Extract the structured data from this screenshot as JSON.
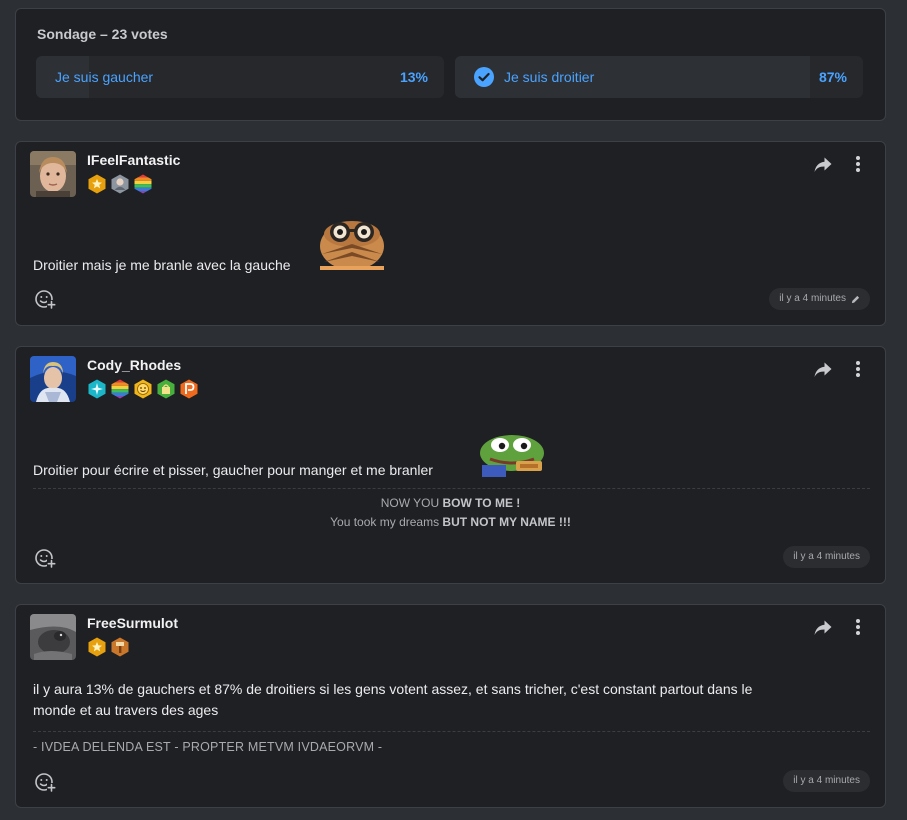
{
  "poll": {
    "title": "Sondage – 23 votes",
    "options": [
      {
        "label": "Je suis gaucher",
        "percent_label": "13%",
        "percent": 13,
        "selected": false
      },
      {
        "label": "Je suis droitier",
        "percent_label": "87%",
        "percent": 87,
        "selected": true
      }
    ]
  },
  "posts": [
    {
      "username": "IFeelFantastic",
      "text": "Droitier mais je me branle avec la gauche",
      "time": "il y a 4 minutes",
      "edited": true,
      "badges": [
        "star-badge",
        "profile-badge",
        "rainbow-badge"
      ]
    },
    {
      "username": "Cody_Rhodes",
      "text": "Droitier pour écrire et pisser, gaucher pour manger et me branler",
      "signature": {
        "line1_prefix": "NOW YOU ",
        "line1_bold": "BOW TO ME !",
        "line2_prefix": "You took my dreams ",
        "line2_bold": "BUT NOT MY NAME !!!"
      },
      "time": "il y a 4 minutes",
      "badges": [
        "sparkle-badge",
        "rainbow-badge",
        "smile-badge",
        "shopping-badge",
        "p-badge"
      ]
    },
    {
      "username": "FreeSurmulot",
      "text_line1": "il y aura 13% de gauchers et 87% de droitiers si les gens votent assez, et sans tricher, c'est constant partout dans le",
      "text_line2": "monde et au travers des ages",
      "signature": "- IVDEA DELENDA EST - PROPTER METVM IVDAEORVM -",
      "time": "il y a 4 minutes",
      "badges": [
        "star-badge",
        "hammer-badge"
      ]
    }
  ],
  "colors": {
    "accent": "#4aa3ff",
    "card_bg": "#1f2024",
    "page_bg": "#2c2f34"
  }
}
